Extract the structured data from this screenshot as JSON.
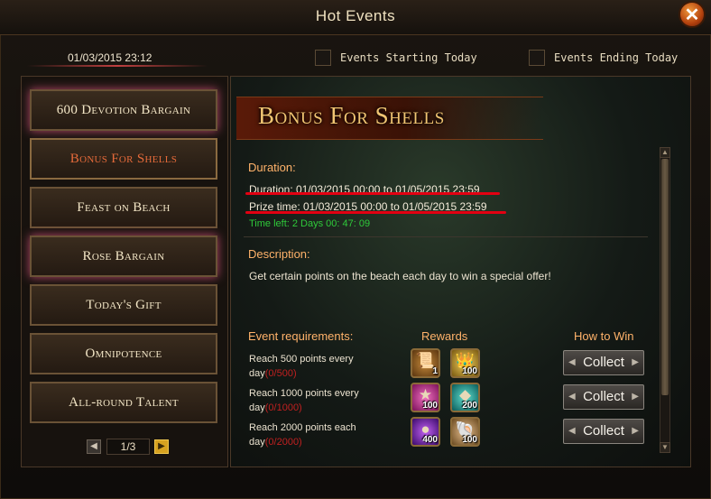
{
  "window": {
    "title": "Hot Events"
  },
  "header": {
    "datetime": "01/03/2015 23:12",
    "filters": [
      {
        "label": "Events Starting Today",
        "checked": false
      },
      {
        "label": "Events Ending Today",
        "checked": false
      }
    ]
  },
  "sidebar": {
    "items": [
      {
        "label": "600 Devotion Bargain"
      },
      {
        "label": "Bonus For Shells",
        "active": true
      },
      {
        "label": "Feast on Beach"
      },
      {
        "label": "Rose Bargain"
      },
      {
        "label": "Today's Gift"
      },
      {
        "label": "Omnipotence"
      },
      {
        "label": "All-round Talent"
      }
    ],
    "pager": {
      "text": "1/3",
      "prev": "◀",
      "next": "▶"
    }
  },
  "event": {
    "title": "Bonus For Shells",
    "duration_heading": "Duration:",
    "duration_line": "Duration: 01/03/2015 00:00 to 01/05/2015 23:59",
    "prize_line": "Prize time: 01/03/2015 00:00 to 01/05/2015 23:59",
    "time_left": "Time left: 2 Days  00: 47: 09",
    "description_heading": "Description:",
    "description": "Get certain points on the beach each day to win a special offer!",
    "requirements_heading": "Event requirements:",
    "rewards_heading": "Rewards",
    "how_to_win_heading": "How to Win",
    "requirements": [
      {
        "line1": "Reach 500 points every",
        "line2": "day",
        "progress": "(0/500)",
        "rewards": [
          {
            "qty": "1",
            "icon": "scroll-icon"
          },
          {
            "qty": "100",
            "icon": "crown-icon"
          }
        ],
        "button": "Collect"
      },
      {
        "line1": "Reach 1000 points every",
        "line2": "day",
        "progress": "(0/1000)",
        "rewards": [
          {
            "qty": "100",
            "icon": "star-icon"
          },
          {
            "qty": "200",
            "icon": "gem-icon"
          }
        ],
        "button": "Collect"
      },
      {
        "line1": "Reach 2000 points each",
        "line2": "day",
        "progress": "(0/2000)",
        "rewards": [
          {
            "qty": "400",
            "icon": "orb-icon"
          },
          {
            "qty": "100",
            "icon": "shell-icon"
          }
        ],
        "button": "Collect"
      }
    ]
  },
  "icons": {
    "close": "✕",
    "scroll_up": "▲",
    "scroll_down": "▼",
    "collect_arrow_left": "◀",
    "collect_arrow_right": "▶"
  },
  "colors": {
    "accent": "#e56a3a",
    "heading": "#ffb26a",
    "time_left": "#2fca3a",
    "progress": "#c02020",
    "underline": "#e30012",
    "title_gold": "#f1c572"
  }
}
